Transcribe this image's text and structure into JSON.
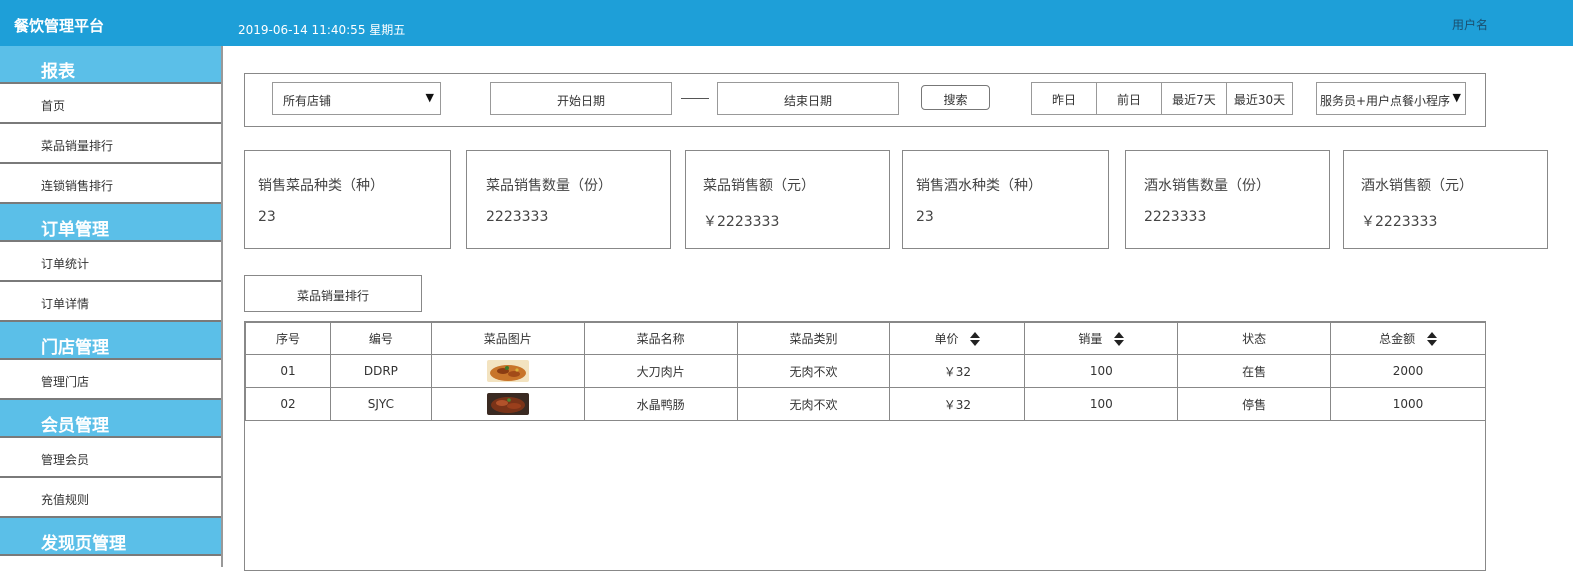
{
  "header": {
    "app_title": "餐饮管理平台",
    "datetime": "2019-06-14 11:40:55 星期五",
    "username": "用户名"
  },
  "sidebar": {
    "sections": [
      {
        "title": "报表",
        "items": [
          "首页",
          "菜品销量排行",
          "连锁销售排行"
        ]
      },
      {
        "title": "订单管理",
        "items": [
          "订单统计",
          "订单详情"
        ]
      },
      {
        "title": "门店管理",
        "items": [
          "管理门店"
        ]
      },
      {
        "title": "会员管理",
        "items": [
          "管理会员",
          "充值规则"
        ]
      },
      {
        "title": "发现页管理",
        "items": []
      }
    ]
  },
  "filters": {
    "store_select": "所有店铺",
    "start_date_placeholder": "开始日期",
    "end_date_placeholder": "结束日期",
    "search_label": "搜索",
    "quick_ranges": [
      "昨日",
      "前日",
      "最近7天",
      "最近30天"
    ],
    "channel_select": "服务员+用户点餐小程序"
  },
  "stats": [
    {
      "label": "销售菜品种类（种）",
      "value": "23"
    },
    {
      "label": "菜品销售数量（份）",
      "value": "2223333"
    },
    {
      "label": "菜品销售额（元）",
      "value": "￥2223333"
    },
    {
      "label": "销售酒水种类（种）",
      "value": "23"
    },
    {
      "label": "酒水销售数量（份）",
      "value": "2223333"
    },
    {
      "label": "酒水销售额（元）",
      "value": "￥2223333"
    }
  ],
  "tab_label": "菜品销量排行",
  "table": {
    "columns": [
      "序号",
      "编号",
      "菜品图片",
      "菜品名称",
      "菜品类别",
      "单价",
      "销量",
      "状态",
      "总金额"
    ],
    "rows": [
      {
        "index": "01",
        "code": "DDRP",
        "image": "dish-photo-icon",
        "name": "大刀肉片",
        "category": "无肉不欢",
        "price": "￥32",
        "sales": "100",
        "status": "在售",
        "total": "2000"
      },
      {
        "index": "02",
        "code": "SJYC",
        "image": "dish-photo-icon",
        "name": "水晶鸭肠",
        "category": "无肉不欢",
        "price": "￥32",
        "sales": "100",
        "status": "停售",
        "total": "1000"
      }
    ]
  },
  "colors": {
    "header_bg": "#1e9fd8",
    "sidebar_section_bg": "#5bbfe8"
  }
}
